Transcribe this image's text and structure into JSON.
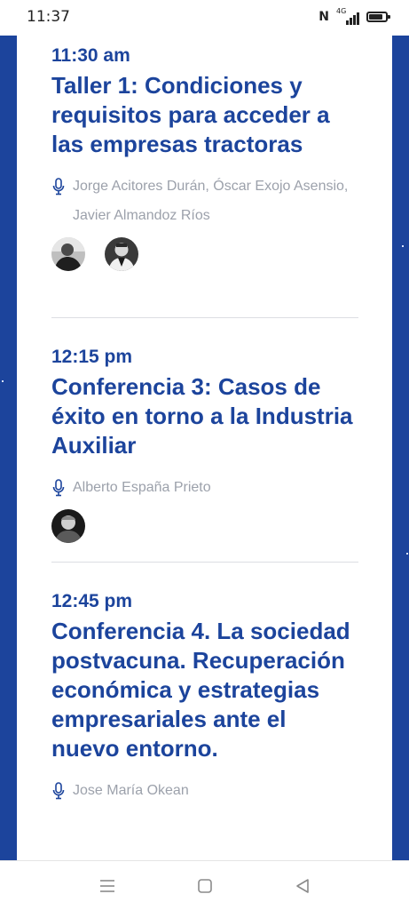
{
  "status_bar": {
    "time": "11:37",
    "nfc_glyph": "N",
    "network_label": "4G",
    "icons": [
      "nfc-icon",
      "signal-icon",
      "battery-icon"
    ]
  },
  "theme": {
    "accent": "#1c449c",
    "muted": "#9ca1ab",
    "divider": "#dcdde2"
  },
  "sessions": [
    {
      "time": "11:30 am",
      "title": "Taller 1: Condiciones y requisitos para acceder a las empresas tractoras",
      "speakers": "Jorge Acitores Durán, Óscar Exojo Asensio, Javier Almandoz Ríos",
      "avatar_count": 2
    },
    {
      "time": "12:15 pm",
      "title": "Conferencia 3: Casos de éxito en torno a la Industria Auxiliar",
      "speakers": "Alberto España Prieto",
      "avatar_count": 1
    },
    {
      "time": "12:45 pm",
      "title": "Conferencia 4. La sociedad postvacuna. Recuperación económica y estrategias empresariales ante el nuevo entorno.",
      "speakers": "Jose María Okean",
      "avatar_count": 0
    }
  ],
  "navigation_bar": {
    "icons": [
      "menu-icon",
      "home-square-icon",
      "back-triangle-icon"
    ]
  }
}
